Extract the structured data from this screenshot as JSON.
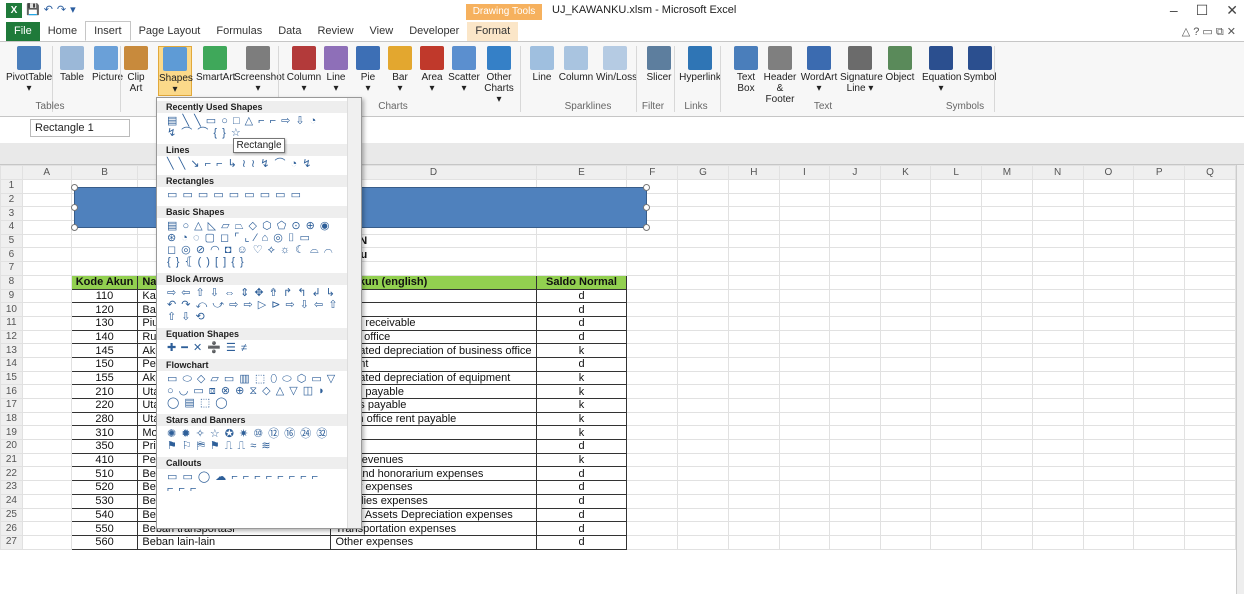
{
  "window": {
    "title": "UJ_KAWANKU.xlsm  -  Microsoft Excel",
    "context_group": "Drawing Tools",
    "app_logo": "X",
    "min": "–",
    "max": "☐",
    "close": "✕",
    "help": "△ ? ▭ ⧉ ✕"
  },
  "tabs": [
    "File",
    "Home",
    "Insert",
    "Page Layout",
    "Formulas",
    "Data",
    "Review",
    "View",
    "Developer",
    "Format"
  ],
  "ribbon": {
    "buttons": [
      {
        "label": "PivotTable",
        "sub": "▾",
        "color": "#4a7ebb"
      },
      {
        "label": "Table",
        "sub": "",
        "color": "#9bb8d8"
      },
      {
        "label": "Picture",
        "sub": "",
        "color": "#6aa0d8"
      },
      {
        "label": "Clip",
        "sub": "Art",
        "color": "#c88a3c"
      },
      {
        "label": "Shapes",
        "sub": "▾",
        "color": "#5e9bd6"
      },
      {
        "label": "SmartArt",
        "sub": "",
        "color": "#3fa85a"
      },
      {
        "label": "Screenshot",
        "sub": "▾",
        "color": "#7d7d7d"
      },
      {
        "label": "Column",
        "sub": "▾",
        "color": "#b33a3a"
      },
      {
        "label": "Line",
        "sub": "▾",
        "color": "#8e6fb8"
      },
      {
        "label": "Pie",
        "sub": "▾",
        "color": "#3d6fb5"
      },
      {
        "label": "Bar",
        "sub": "▾",
        "color": "#e3a72f"
      },
      {
        "label": "Area",
        "sub": "▾",
        "color": "#c0392b"
      },
      {
        "label": "Scatter",
        "sub": "▾",
        "color": "#5b8fcf"
      },
      {
        "label": "Other",
        "sub": "Charts ▾",
        "color": "#3580c7"
      },
      {
        "label": "Line",
        "sub": "",
        "color": "#9fbfdf"
      },
      {
        "label": "Column",
        "sub": "",
        "color": "#a9c4e0"
      },
      {
        "label": "Win/Loss",
        "sub": "",
        "color": "#b5cbe3"
      },
      {
        "label": "Slicer",
        "sub": "",
        "color": "#5d7e9e"
      },
      {
        "label": "Hyperlink",
        "sub": "",
        "color": "#2f75b5"
      },
      {
        "label": "Text",
        "sub": "Box",
        "color": "#4a7ebb"
      },
      {
        "label": "Header",
        "sub": "& Footer",
        "color": "#7f7f7f"
      },
      {
        "label": "WordArt",
        "sub": "▾",
        "color": "#3b6bb0"
      },
      {
        "label": "Signature",
        "sub": "Line ▾",
        "color": "#6b6b6b"
      },
      {
        "label": "Object",
        "sub": "",
        "color": "#5a8a5a"
      },
      {
        "label": "Equation",
        "sub": "▾",
        "color": "#2b4f8f"
      },
      {
        "label": "Symbol",
        "sub": "",
        "color": "#2b4f8f"
      }
    ],
    "groups": [
      "Tables",
      "Charts",
      "Sparklines",
      "Filter",
      "Links",
      "Text",
      "Symbols"
    ]
  },
  "namebox": "Rectangle 1",
  "columns": [
    "A",
    "B",
    "C",
    "D",
    "E",
    "F",
    "G",
    "H",
    "I",
    "J",
    "K",
    "L",
    "M",
    "N",
    "O",
    "P",
    "Q"
  ],
  "sheet": {
    "title1": "AKUN",
    "title2": "vanku",
    "headers": [
      "Kode Akun",
      "Nam",
      "na Akun (english)",
      "Saldo Normal"
    ],
    "rows": [
      [
        "110",
        "Kas",
        "h",
        "d"
      ],
      [
        "120",
        "Baha",
        "plies",
        "d"
      ],
      [
        "130",
        "Piuta",
        "ounts receivable",
        "d"
      ],
      [
        "140",
        "Ruan",
        "iness office",
        "d"
      ],
      [
        "145",
        "Akun",
        "umulated depreciation of business office",
        "k"
      ],
      [
        "150",
        "Peral",
        "ipment",
        "d"
      ],
      [
        "155",
        "Akun",
        "umulated depreciation of equipment",
        "k"
      ],
      [
        "210",
        "Utan",
        "ounts payable",
        "k"
      ],
      [
        "220",
        "Utan",
        "enses payable",
        "k"
      ],
      [
        "280",
        "Utan",
        "gterm office rent payable",
        "k"
      ],
      [
        "310",
        "Moda",
        "ital",
        "k"
      ],
      [
        "350",
        "Prive",
        "wing",
        "d"
      ],
      [
        "410",
        "Peng",
        "vice revenues",
        "k"
      ],
      [
        "510",
        "Beba",
        "ges and honorarium expenses",
        "d"
      ],
      [
        "520",
        "Beban utilitas",
        "Utility expenses",
        "d"
      ],
      [
        "530",
        "Beban bahan habis pakai",
        "Supplies expenses",
        "d"
      ],
      [
        "540",
        "Beban depresiasi aset tetap berwujud",
        "Fixed Assets Depreciation expenses",
        "d"
      ],
      [
        "550",
        "Beban transportasi",
        "Transportation expenses",
        "d"
      ],
      [
        "560",
        "Beban lain-lain",
        "Other expenses",
        "d"
      ]
    ]
  },
  "dropdown": {
    "sections": [
      {
        "title": "Recently Used Shapes",
        "rows": [
          "▤ ╲ ╲ ▭ ○ □ △ ⌐ ⌐ ⇨ ⇩ ◔",
          "↯ ⌒ ⌒ { } ☆"
        ]
      },
      {
        "title": "Lines",
        "rows": [
          "╲ ╲ ↘ ⌐ ⌐ ↳ ≀ ≀ ↯ ⌒ ◔ ↯"
        ]
      },
      {
        "title": "Rectangles",
        "rows": [
          "▭ ▭ ▭ ▭ ▭ ▭ ▭ ▭ ▭"
        ]
      },
      {
        "title": "Basic Shapes",
        "rows": [
          "▤ ○ △ ◺ ▱ ⏢ ◇ ⬡ ⬠ ⊙ ⊕ ◉",
          "⊛ ◔ ◌ ▢ ◻ ⌜ ⌞ ⁄ ⌂ ◎ ⌷ ▭",
          "◻ ◎ ⊘ ◠ ◘ ☺ ♡ ⟡ ☼ ☾ ⌓ ⌒",
          "{ } ⦃ ( ) [ ] { }"
        ]
      },
      {
        "title": "Block Arrows",
        "rows": [
          "⇨ ⇦ ⇧ ⇩ ⇔ ⇕ ✥ ⇮ ↱ ↰ ↲ ↳",
          "↶ ↷ ⤺ ⤻ ⇨ ⇨ ▷ ⊳ ⇨ ⇩ ⇦ ⇧",
          "⇧ ⇩ ⟲"
        ]
      },
      {
        "title": "Equation Shapes",
        "rows": [
          "✚ ━ ✕ ➗ ☰ ≠"
        ]
      },
      {
        "title": "Flowchart",
        "rows": [
          "▭ ⬭ ◇ ▱ ▭ ▥ ⬚ ⬯ ⬭ ⬡ ▭ ▽",
          "○ ◡ ▭ ⧈ ⊗ ⊕ ⧖ ◇ △ ▽ ◫ ◗",
          "◯ ▤ ⬚ ◯"
        ]
      },
      {
        "title": "Stars and Banners",
        "rows": [
          "✺ ✹ ✧ ☆ ✪ ✷ ⑩ ⑫ ⑯ ㉔ ㉜",
          "⚑ ⚐ ⛿ ⚑ ⎍ ⎍ ≈ ≋"
        ]
      },
      {
        "title": "Callouts",
        "rows": [
          "▭ ▭ ◯ ☁ ⌐ ⌐ ⌐ ⌐ ⌐ ⌐ ⌐ ⌐",
          "⌐ ⌐ ⌐"
        ]
      }
    ],
    "tooltip": "Rectangle"
  }
}
